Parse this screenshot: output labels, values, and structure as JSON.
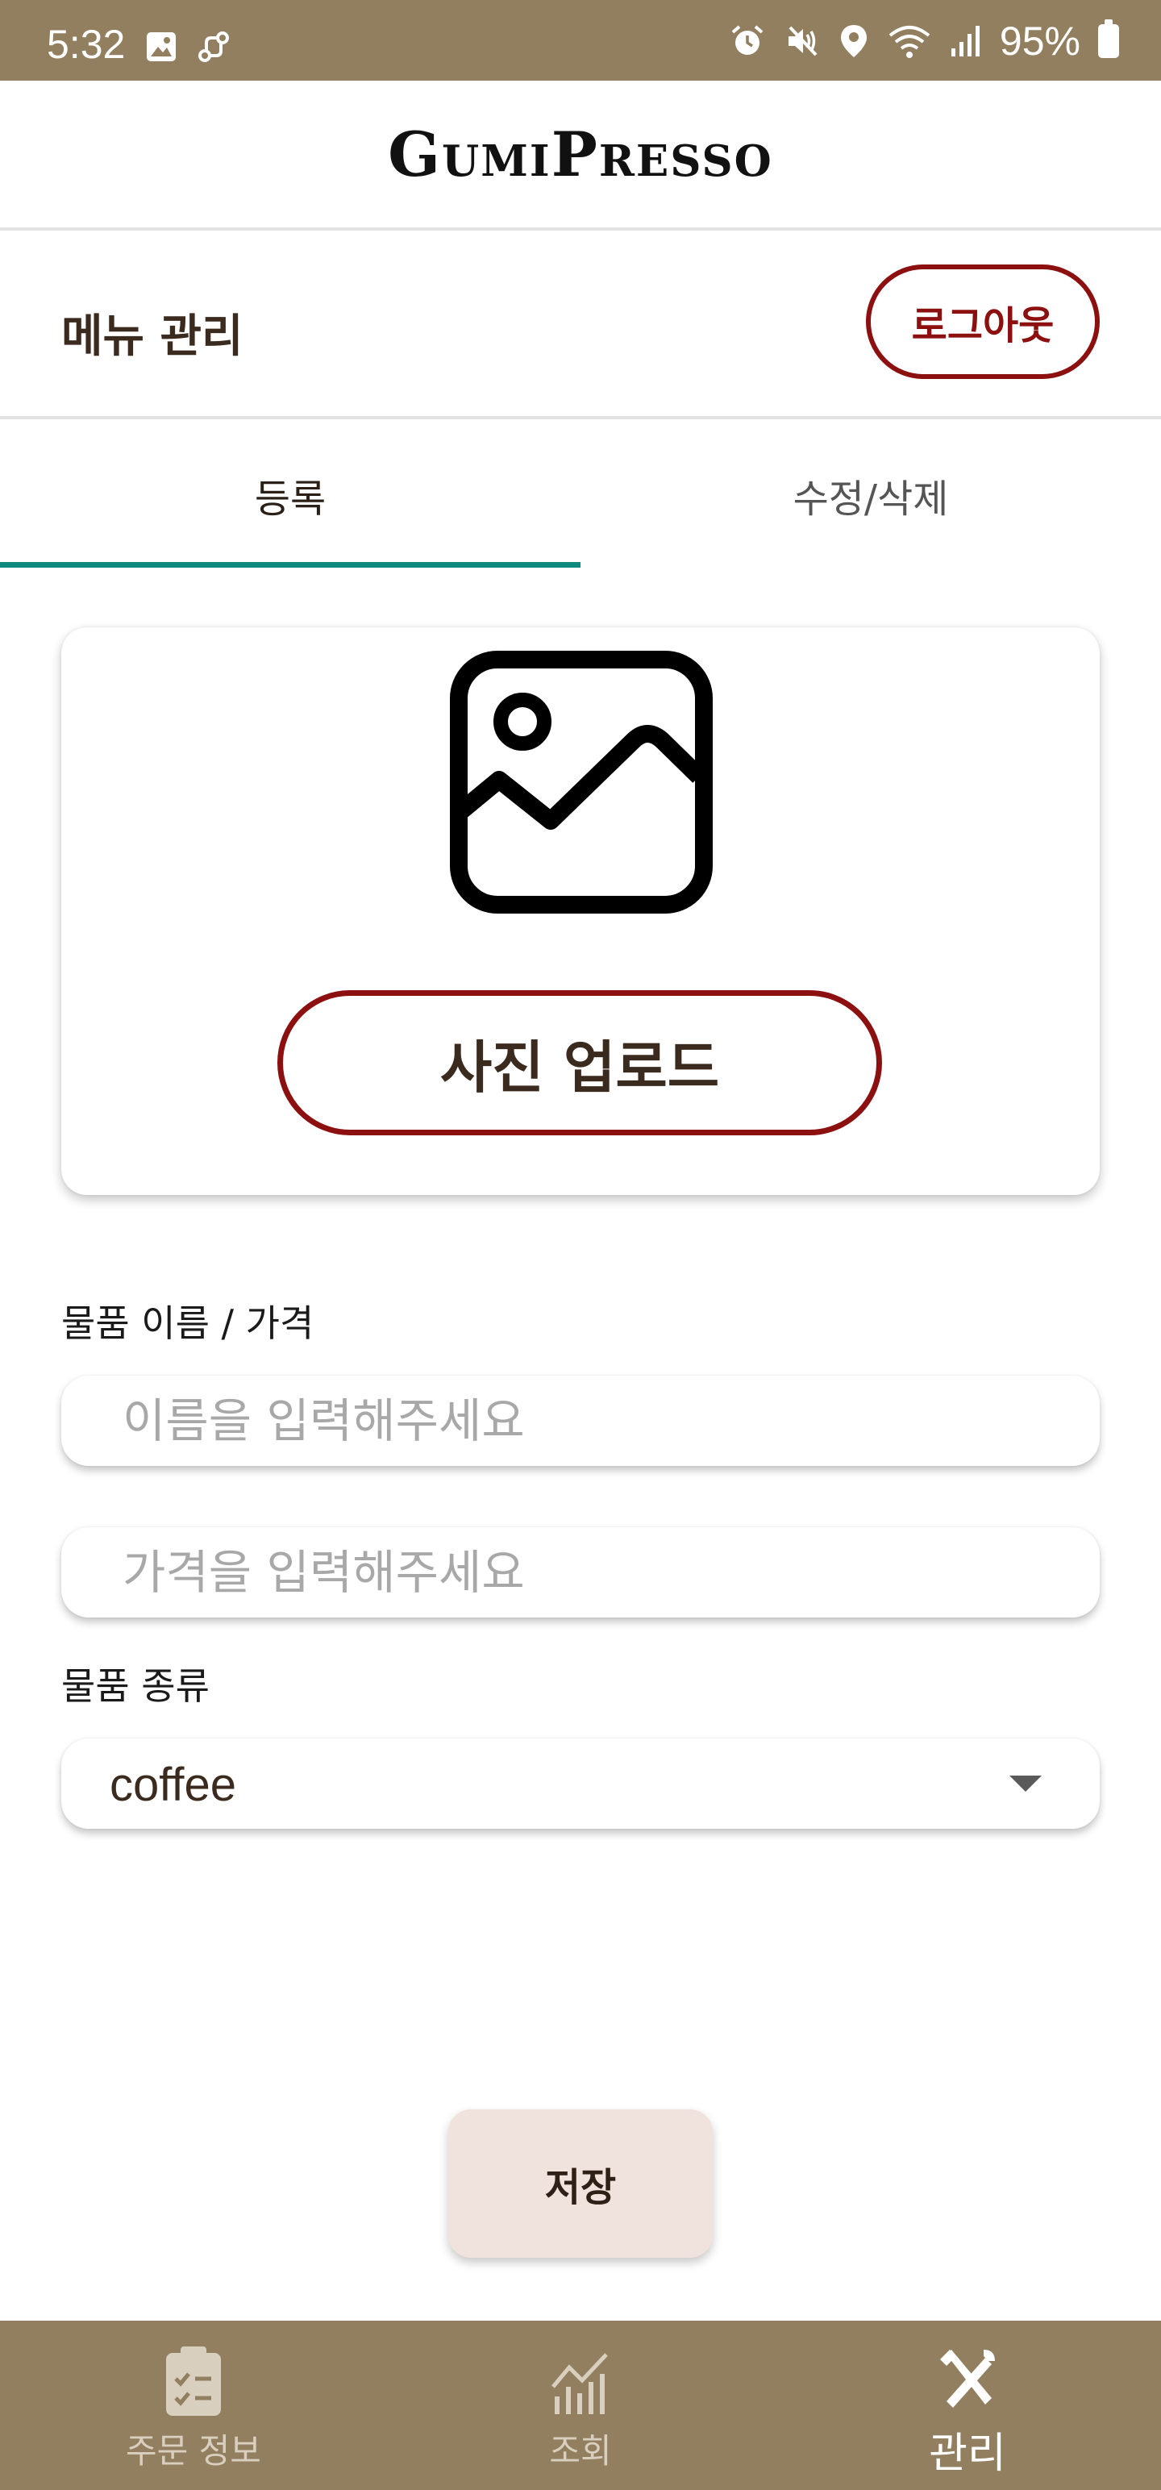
{
  "status_bar": {
    "time": "5:32",
    "battery": "95%",
    "left_icons": [
      "image-icon",
      "link-icon"
    ],
    "right_icons": [
      "alarm-icon",
      "mute-icon",
      "location-icon",
      "wifi-icon",
      "signal-icon",
      "battery-icon"
    ]
  },
  "app": {
    "title": "GumiPresso"
  },
  "page": {
    "title": "메뉴 관리",
    "logout_label": "로그아웃"
  },
  "tabs": [
    {
      "label": "등록",
      "selected": true
    },
    {
      "label": "수정/삭제",
      "selected": false
    }
  ],
  "image_card": {
    "placeholder_icon": "image-placeholder-icon",
    "upload_label": "사진 업로드"
  },
  "form": {
    "name_price_label": "물품 이름 / 가격",
    "name_placeholder": "이름을 입력해주세요",
    "price_placeholder": "가격을 입력해주세요",
    "type_label": "물품 종류",
    "type_selected": "coffee"
  },
  "save_label": "저장",
  "bottom_nav": [
    {
      "label": "주문 정보",
      "icon": "clipboard-check-icon",
      "active": false
    },
    {
      "label": "조회",
      "icon": "chart-icon",
      "active": false
    },
    {
      "label": "관리",
      "icon": "tools-icon",
      "active": true
    }
  ],
  "colors": {
    "status_bar": "#927f60",
    "accent_red": "#8c1010",
    "tab_indicator": "#0e8a7e",
    "save_button": "#f0e2dc"
  }
}
